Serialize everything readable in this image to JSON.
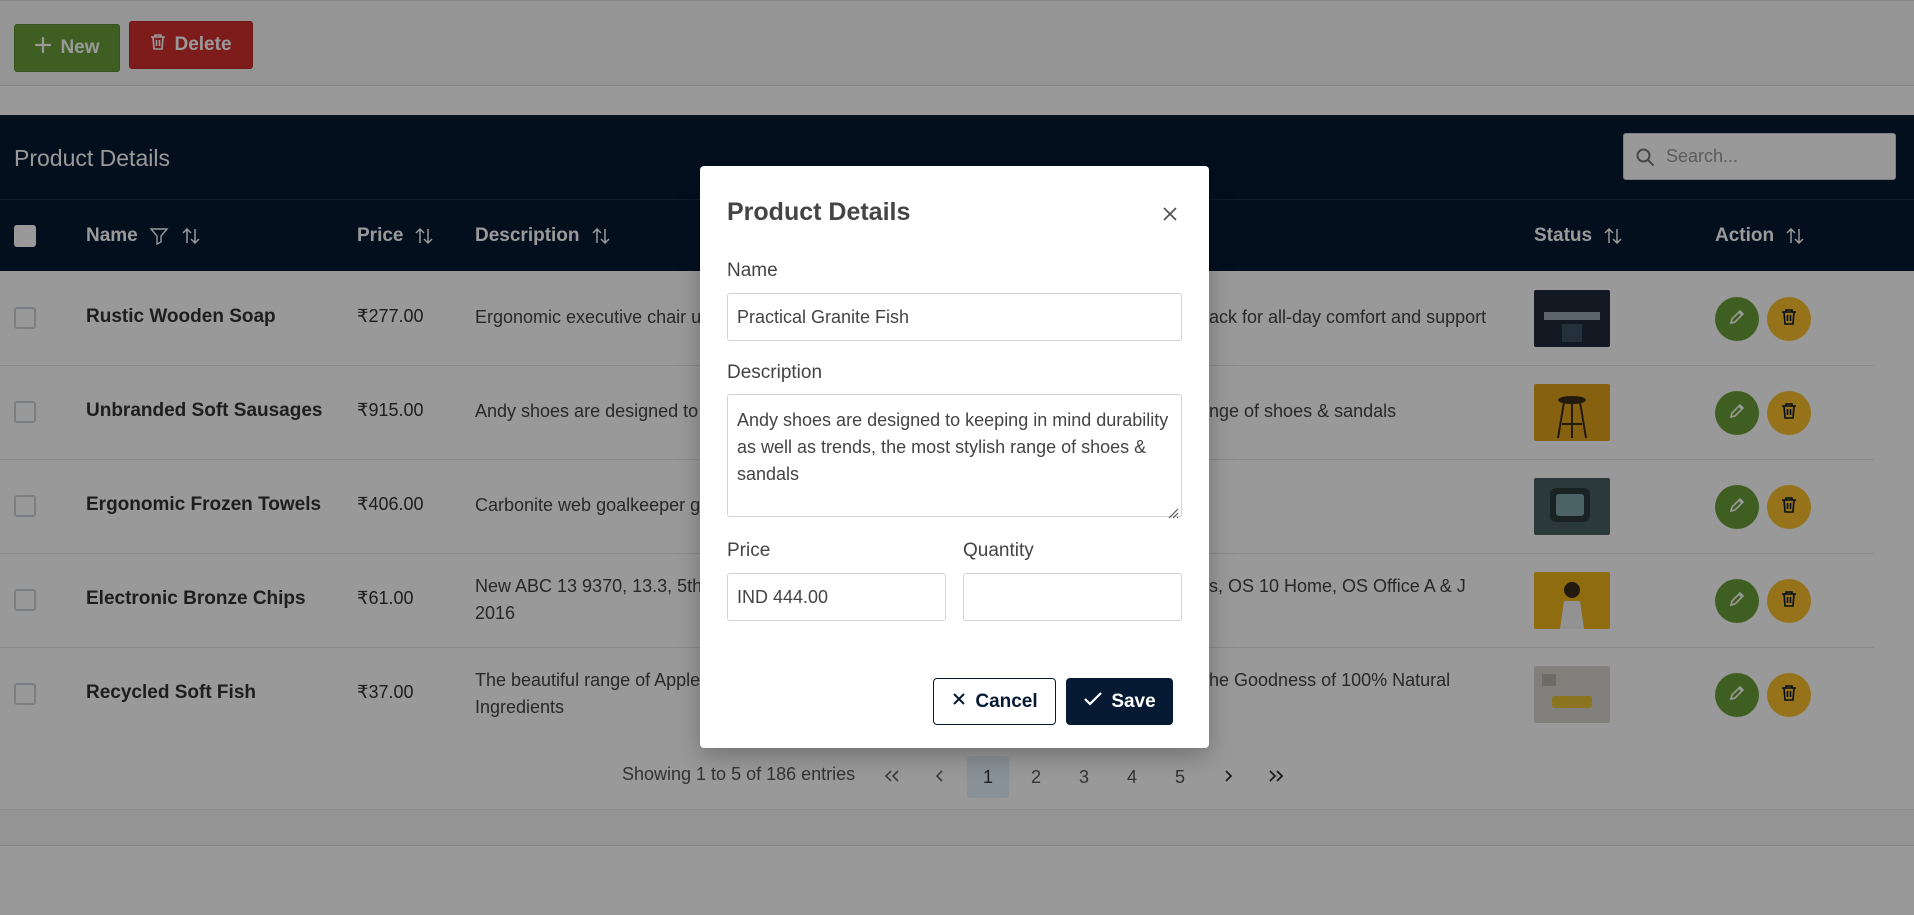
{
  "toolbar": {
    "new_label": "New",
    "delete_label": "Delete"
  },
  "table": {
    "title": "Product Details",
    "search_placeholder": "Search...",
    "columns": {
      "name": "Name",
      "price": "Price",
      "description": "Description",
      "status": "Status",
      "action": "Action"
    },
    "rows": [
      {
        "name": "Rustic Wooden Soap",
        "price": "₹277.00",
        "desc_left": "Ergonomic executive chair u",
        "desc_right": "ack for all-day comfort and support",
        "thumb_color": "#1e2b3a"
      },
      {
        "name": "Unbranded Soft Sausages",
        "price": "₹915.00",
        "desc_left": "Andy shoes are designed to",
        "desc_right": "nge of shoes & sandals",
        "thumb_color": "#e0a21a"
      },
      {
        "name": "Ergonomic Frozen Towels",
        "price": "₹406.00",
        "desc_left": "Carbonite web goalkeeper g",
        "desc_right": "",
        "thumb_color": "#4a5f63"
      },
      {
        "name": "Electronic Bronze Chips",
        "price": "₹61.00",
        "desc_left": "New ABC 13 9370, 13.3, 5th",
        "desc_left_2": "2016",
        "desc_right": "s, OS 10 Home, OS Office A & J",
        "thumb_color": "#f0b51d"
      },
      {
        "name": "Recycled Soft Fish",
        "price": "₹37.00",
        "desc_left": "The beautiful range of Apple",
        "desc_left_2": "Ingredients",
        "desc_right": "he Goodness of 100% Natural",
        "thumb_color": "#d8d6cf"
      }
    ]
  },
  "paginator": {
    "report": "Showing 1 to 5 of 186 entries",
    "pages": [
      "1",
      "2",
      "3",
      "4",
      "5"
    ],
    "active_page": "1"
  },
  "dialog": {
    "title": "Product Details",
    "name_label": "Name",
    "name_value": "Practical Granite Fish",
    "description_label": "Description",
    "description_value": "Andy shoes are designed to keeping in mind durability as well as trends, the most stylish range of shoes & sandals",
    "price_label": "Price",
    "price_value": "IND 444.00",
    "quantity_label": "Quantity",
    "quantity_value": "",
    "cancel_label": "Cancel",
    "save_label": "Save"
  },
  "colors": {
    "primary_dark": "#071a33",
    "success": "#689f38",
    "danger": "#d32f2f",
    "warning": "#fbc02d"
  }
}
